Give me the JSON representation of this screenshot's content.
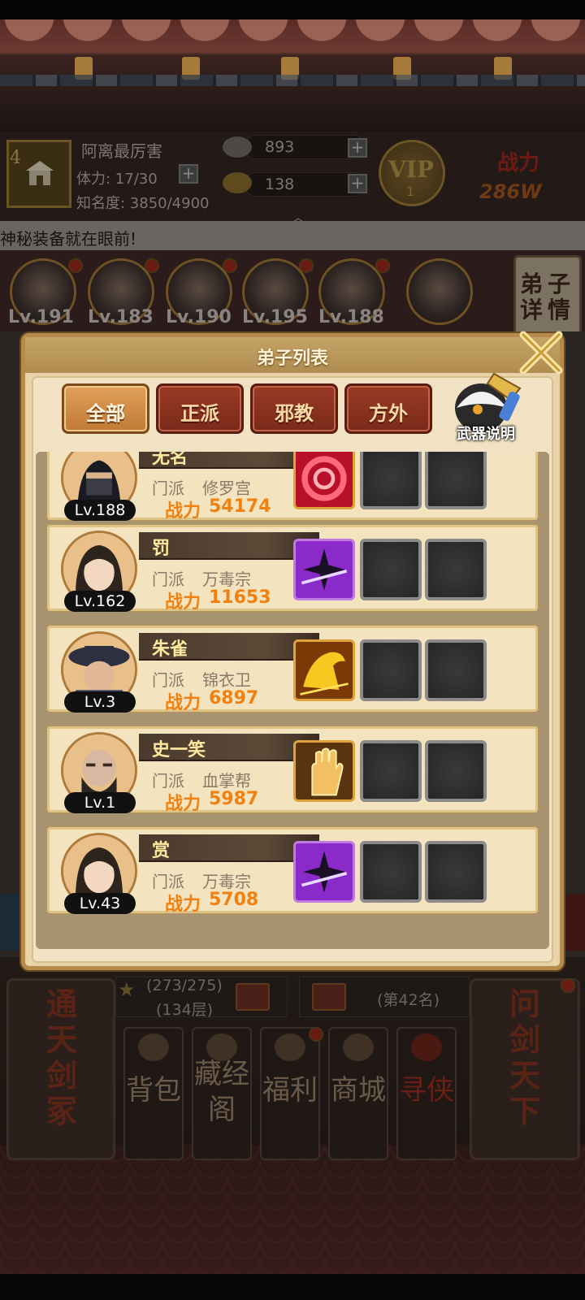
{
  "player": {
    "level": "4",
    "name": "阿离最厉害",
    "stamina": "体力: 17/30",
    "fame": "知名度: 3850/4900",
    "silver": "893",
    "gold": "138",
    "vip_label": "VIP",
    "vip_level": "1",
    "power_label": "战力",
    "power_value": "286W"
  },
  "marquee": "神秘装备就在眼前!",
  "top_heroes": [
    {
      "level": "Lv.191"
    },
    {
      "level": "Lv.183"
    },
    {
      "level": "Lv.190"
    },
    {
      "level": "Lv.195"
    },
    {
      "level": "Lv.188"
    }
  ],
  "detail_button": "弟子详情",
  "modal": {
    "title": "弟子列表",
    "tabs": [
      "全部",
      "正派",
      "邪教",
      "方外"
    ],
    "weapon_help": "武器说明",
    "sect_label": "门派",
    "power_label": "战力",
    "disciples": [
      {
        "name": "无名",
        "level": "Lv.188",
        "sect": "修罗宫",
        "power": "54174",
        "weapon": "red-swirl"
      },
      {
        "name": "罚",
        "level": "Lv.162",
        "sect": "万毒宗",
        "power": "11653",
        "weapon": "purple-shuriken"
      },
      {
        "name": "朱雀",
        "level": "Lv.3",
        "sect": "锦衣卫",
        "power": "6897",
        "weapon": "golden-horse"
      },
      {
        "name": "史一笑",
        "level": "Lv.1",
        "sect": "血掌帮",
        "power": "5987",
        "weapon": "golden-palm"
      },
      {
        "name": "赏",
        "level": "Lv.43",
        "sect": "万毒宗",
        "power": "5708",
        "weapon": "purple-shuriken"
      }
    ]
  },
  "bottom": {
    "tower_progress": "(273/275)",
    "tower_floor": "(134层)",
    "rank": "(第42名)",
    "left_banner": "通天剑冢",
    "right_banner": "问剑天下",
    "menu": [
      {
        "label": "背包",
        "icon": "bag-icon"
      },
      {
        "label": "藏经阁",
        "icon": "pavilion-icon"
      },
      {
        "label": "福利",
        "icon": "gift-box-icon"
      },
      {
        "label": "商城",
        "icon": "shop-icon"
      },
      {
        "label": "寻侠",
        "icon": "seek-icon"
      }
    ]
  },
  "colors": {
    "modal_bg": "#e8d4a8",
    "tab_red": "#9a3a26",
    "tab_active": "#e0a05a",
    "power_orange": "#f08010"
  }
}
